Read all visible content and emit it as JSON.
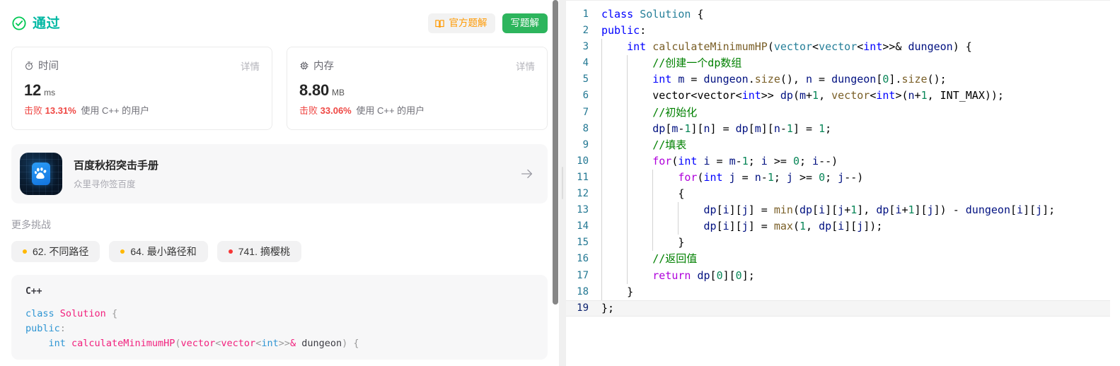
{
  "status": {
    "icon": "circle-check-icon",
    "label": "通过",
    "color": "#00b8a3"
  },
  "actions": {
    "official_solution": {
      "icon": "book-icon",
      "label": "官方题解"
    },
    "write_solution": {
      "label": "写题解"
    }
  },
  "metrics": [
    {
      "key": "time",
      "icon": "stopwatch-icon",
      "label": "时间",
      "detail_label": "详情",
      "value": "12",
      "unit": "ms",
      "beat_label": "击败",
      "beat_percent": "13.31%",
      "beat_rest": "使用 C++ 的用户"
    },
    {
      "key": "memory",
      "icon": "chip-icon",
      "label": "内存",
      "detail_label": "详情",
      "value": "8.80",
      "unit": "MB",
      "beat_label": "击败",
      "beat_percent": "33.06%",
      "beat_rest": "使用 C++ 的用户"
    }
  ],
  "promo": {
    "logo_icon": "baidu-paw-icon",
    "title": "百度秋招突击手册",
    "subtitle": "众里寻你签百度",
    "arrow_icon": "arrow-right-icon"
  },
  "more_challenges": {
    "title": "更多挑战",
    "tags": [
      {
        "label": "62. 不同路径",
        "dot_color": "#ffb800"
      },
      {
        "label": "64. 最小路径和",
        "dot_color": "#ffb800"
      },
      {
        "label": "741. 摘樱桃",
        "dot_color": "#f63636"
      }
    ]
  },
  "code_preview": {
    "language": "C++",
    "lines": [
      [
        {
          "t": "class ",
          "c": "p-kw"
        },
        {
          "t": "Solution",
          "c": "p-cls"
        },
        {
          "t": " {",
          "c": "p-pn"
        }
      ],
      [
        {
          "t": "public",
          "c": "p-kw"
        },
        {
          "t": ":",
          "c": "p-pn"
        }
      ],
      [
        {
          "t": "    ",
          "c": "p-var"
        },
        {
          "t": "int",
          "c": "p-type"
        },
        {
          "t": " ",
          "c": "p-var"
        },
        {
          "t": "calculateMinimumHP",
          "c": "p-fn"
        },
        {
          "t": "(",
          "c": "p-pn"
        },
        {
          "t": "vector",
          "c": "p-cls"
        },
        {
          "t": "<",
          "c": "p-pn"
        },
        {
          "t": "vector",
          "c": "p-cls"
        },
        {
          "t": "<",
          "c": "p-pn"
        },
        {
          "t": "int",
          "c": "p-type"
        },
        {
          "t": ">>",
          "c": "p-pn"
        },
        {
          "t": "&",
          "c": "p-amp"
        },
        {
          "t": " dungeon",
          "c": "p-var"
        },
        {
          "t": ") {",
          "c": "p-pn"
        }
      ]
    ]
  },
  "editor": {
    "scrollbar_visible": true,
    "active_line": 19,
    "lines": [
      {
        "n": "1",
        "indent": 0,
        "tokens": [
          {
            "t": "class ",
            "c": "t-kw"
          },
          {
            "t": "Solution",
            "c": "t-cls"
          },
          {
            "t": " {",
            "c": "t-op"
          }
        ]
      },
      {
        "n": "2",
        "indent": 0,
        "tokens": [
          {
            "t": "public",
            "c": "t-kw"
          },
          {
            "t": ":",
            "c": "t-op"
          }
        ]
      },
      {
        "n": "3",
        "indent": 1,
        "tokens": [
          {
            "t": "    ",
            "c": "t-op"
          },
          {
            "t": "int",
            "c": "t-kw"
          },
          {
            "t": " ",
            "c": "t-op"
          },
          {
            "t": "calculateMinimumHP",
            "c": "t-fn"
          },
          {
            "t": "(",
            "c": "t-op"
          },
          {
            "t": "vector",
            "c": "t-cls"
          },
          {
            "t": "<",
            "c": "t-op"
          },
          {
            "t": "vector",
            "c": "t-cls"
          },
          {
            "t": "<",
            "c": "t-op"
          },
          {
            "t": "int",
            "c": "t-kw"
          },
          {
            "t": ">>& ",
            "c": "t-op"
          },
          {
            "t": "dungeon",
            "c": "t-var"
          },
          {
            "t": ") {",
            "c": "t-op"
          }
        ]
      },
      {
        "n": "4",
        "indent": 2,
        "tokens": [
          {
            "t": "        ",
            "c": "t-op"
          },
          {
            "t": "//创建一个dp数组",
            "c": "t-cmt"
          }
        ]
      },
      {
        "n": "5",
        "indent": 2,
        "tokens": [
          {
            "t": "        ",
            "c": "t-op"
          },
          {
            "t": "int",
            "c": "t-kw"
          },
          {
            "t": " ",
            "c": "t-op"
          },
          {
            "t": "m",
            "c": "t-var"
          },
          {
            "t": " = ",
            "c": "t-op"
          },
          {
            "t": "dungeon",
            "c": "t-var"
          },
          {
            "t": ".",
            "c": "t-op"
          },
          {
            "t": "size",
            "c": "t-fn"
          },
          {
            "t": "(), ",
            "c": "t-op"
          },
          {
            "t": "n",
            "c": "t-var"
          },
          {
            "t": " = ",
            "c": "t-op"
          },
          {
            "t": "dungeon",
            "c": "t-var"
          },
          {
            "t": "[",
            "c": "t-op"
          },
          {
            "t": "0",
            "c": "t-num"
          },
          {
            "t": "].",
            "c": "t-op"
          },
          {
            "t": "size",
            "c": "t-fn"
          },
          {
            "t": "();",
            "c": "t-op"
          }
        ]
      },
      {
        "n": "6",
        "indent": 2,
        "tokens": [
          {
            "t": "        vector<vector<",
            "c": "t-op"
          },
          {
            "t": "int",
            "c": "t-kw"
          },
          {
            "t": ">> ",
            "c": "t-op"
          },
          {
            "t": "dp",
            "c": "t-var"
          },
          {
            "t": "(",
            "c": "t-op"
          },
          {
            "t": "m",
            "c": "t-var"
          },
          {
            "t": "+",
            "c": "t-op"
          },
          {
            "t": "1",
            "c": "t-num"
          },
          {
            "t": ", ",
            "c": "t-op"
          },
          {
            "t": "vector",
            "c": "t-fn"
          },
          {
            "t": "<",
            "c": "t-op"
          },
          {
            "t": "int",
            "c": "t-kw"
          },
          {
            "t": ">(",
            "c": "t-op"
          },
          {
            "t": "n",
            "c": "t-var"
          },
          {
            "t": "+",
            "c": "t-op"
          },
          {
            "t": "1",
            "c": "t-num"
          },
          {
            "t": ", ",
            "c": "t-op"
          },
          {
            "t": "INT_MAX",
            "c": "t-op"
          },
          {
            "t": "));",
            "c": "t-op"
          }
        ]
      },
      {
        "n": "7",
        "indent": 2,
        "tokens": [
          {
            "t": "        ",
            "c": "t-op"
          },
          {
            "t": "//初始化",
            "c": "t-cmt"
          }
        ]
      },
      {
        "n": "8",
        "indent": 2,
        "tokens": [
          {
            "t": "        ",
            "c": "t-op"
          },
          {
            "t": "dp",
            "c": "t-var"
          },
          {
            "t": "[",
            "c": "t-op"
          },
          {
            "t": "m",
            "c": "t-var"
          },
          {
            "t": "-",
            "c": "t-op"
          },
          {
            "t": "1",
            "c": "t-num"
          },
          {
            "t": "][",
            "c": "t-op"
          },
          {
            "t": "n",
            "c": "t-var"
          },
          {
            "t": "] = ",
            "c": "t-op"
          },
          {
            "t": "dp",
            "c": "t-var"
          },
          {
            "t": "[",
            "c": "t-op"
          },
          {
            "t": "m",
            "c": "t-var"
          },
          {
            "t": "][",
            "c": "t-op"
          },
          {
            "t": "n",
            "c": "t-var"
          },
          {
            "t": "-",
            "c": "t-op"
          },
          {
            "t": "1",
            "c": "t-num"
          },
          {
            "t": "] = ",
            "c": "t-op"
          },
          {
            "t": "1",
            "c": "t-num"
          },
          {
            "t": ";",
            "c": "t-op"
          }
        ]
      },
      {
        "n": "9",
        "indent": 2,
        "tokens": [
          {
            "t": "        ",
            "c": "t-op"
          },
          {
            "t": "//填表",
            "c": "t-cmt"
          }
        ]
      },
      {
        "n": "10",
        "indent": 2,
        "tokens": [
          {
            "t": "        ",
            "c": "t-op"
          },
          {
            "t": "for",
            "c": "t-ctl"
          },
          {
            "t": "(",
            "c": "t-op"
          },
          {
            "t": "int",
            "c": "t-kw"
          },
          {
            "t": " ",
            "c": "t-op"
          },
          {
            "t": "i",
            "c": "t-var"
          },
          {
            "t": " = ",
            "c": "t-op"
          },
          {
            "t": "m",
            "c": "t-var"
          },
          {
            "t": "-",
            "c": "t-op"
          },
          {
            "t": "1",
            "c": "t-num"
          },
          {
            "t": "; ",
            "c": "t-op"
          },
          {
            "t": "i",
            "c": "t-var"
          },
          {
            "t": " >= ",
            "c": "t-op"
          },
          {
            "t": "0",
            "c": "t-num"
          },
          {
            "t": "; ",
            "c": "t-op"
          },
          {
            "t": "i",
            "c": "t-var"
          },
          {
            "t": "--)",
            "c": "t-op"
          }
        ]
      },
      {
        "n": "11",
        "indent": 3,
        "tokens": [
          {
            "t": "            ",
            "c": "t-op"
          },
          {
            "t": "for",
            "c": "t-ctl"
          },
          {
            "t": "(",
            "c": "t-op"
          },
          {
            "t": "int",
            "c": "t-kw"
          },
          {
            "t": " ",
            "c": "t-op"
          },
          {
            "t": "j",
            "c": "t-var"
          },
          {
            "t": " = ",
            "c": "t-op"
          },
          {
            "t": "n",
            "c": "t-var"
          },
          {
            "t": "-",
            "c": "t-op"
          },
          {
            "t": "1",
            "c": "t-num"
          },
          {
            "t": "; ",
            "c": "t-op"
          },
          {
            "t": "j",
            "c": "t-var"
          },
          {
            "t": " >= ",
            "c": "t-op"
          },
          {
            "t": "0",
            "c": "t-num"
          },
          {
            "t": "; ",
            "c": "t-op"
          },
          {
            "t": "j",
            "c": "t-var"
          },
          {
            "t": "--)",
            "c": "t-op"
          }
        ]
      },
      {
        "n": "12",
        "indent": 3,
        "tokens": [
          {
            "t": "            {",
            "c": "t-op"
          }
        ]
      },
      {
        "n": "13",
        "indent": 4,
        "tokens": [
          {
            "t": "                ",
            "c": "t-op"
          },
          {
            "t": "dp",
            "c": "t-var"
          },
          {
            "t": "[",
            "c": "t-op"
          },
          {
            "t": "i",
            "c": "t-var"
          },
          {
            "t": "][",
            "c": "t-op"
          },
          {
            "t": "j",
            "c": "t-var"
          },
          {
            "t": "] = ",
            "c": "t-op"
          },
          {
            "t": "min",
            "c": "t-fn"
          },
          {
            "t": "(",
            "c": "t-op"
          },
          {
            "t": "dp",
            "c": "t-var"
          },
          {
            "t": "[",
            "c": "t-op"
          },
          {
            "t": "i",
            "c": "t-var"
          },
          {
            "t": "][",
            "c": "t-op"
          },
          {
            "t": "j",
            "c": "t-var"
          },
          {
            "t": "+",
            "c": "t-op"
          },
          {
            "t": "1",
            "c": "t-num"
          },
          {
            "t": "], ",
            "c": "t-op"
          },
          {
            "t": "dp",
            "c": "t-var"
          },
          {
            "t": "[",
            "c": "t-op"
          },
          {
            "t": "i",
            "c": "t-var"
          },
          {
            "t": "+",
            "c": "t-op"
          },
          {
            "t": "1",
            "c": "t-num"
          },
          {
            "t": "][",
            "c": "t-op"
          },
          {
            "t": "j",
            "c": "t-var"
          },
          {
            "t": "]) - ",
            "c": "t-op"
          },
          {
            "t": "dungeon",
            "c": "t-var"
          },
          {
            "t": "[",
            "c": "t-op"
          },
          {
            "t": "i",
            "c": "t-var"
          },
          {
            "t": "][",
            "c": "t-op"
          },
          {
            "t": "j",
            "c": "t-var"
          },
          {
            "t": "];",
            "c": "t-op"
          }
        ]
      },
      {
        "n": "14",
        "indent": 4,
        "tokens": [
          {
            "t": "                ",
            "c": "t-op"
          },
          {
            "t": "dp",
            "c": "t-var"
          },
          {
            "t": "[",
            "c": "t-op"
          },
          {
            "t": "i",
            "c": "t-var"
          },
          {
            "t": "][",
            "c": "t-op"
          },
          {
            "t": "j",
            "c": "t-var"
          },
          {
            "t": "] = ",
            "c": "t-op"
          },
          {
            "t": "max",
            "c": "t-fn"
          },
          {
            "t": "(",
            "c": "t-op"
          },
          {
            "t": "1",
            "c": "t-num"
          },
          {
            "t": ", ",
            "c": "t-op"
          },
          {
            "t": "dp",
            "c": "t-var"
          },
          {
            "t": "[",
            "c": "t-op"
          },
          {
            "t": "i",
            "c": "t-var"
          },
          {
            "t": "][",
            "c": "t-op"
          },
          {
            "t": "j",
            "c": "t-var"
          },
          {
            "t": "]);",
            "c": "t-op"
          }
        ]
      },
      {
        "n": "15",
        "indent": 3,
        "tokens": [
          {
            "t": "            }",
            "c": "t-op"
          }
        ]
      },
      {
        "n": "16",
        "indent": 2,
        "tokens": [
          {
            "t": "        ",
            "c": "t-op"
          },
          {
            "t": "//返回值",
            "c": "t-cmt"
          }
        ]
      },
      {
        "n": "17",
        "indent": 2,
        "tokens": [
          {
            "t": "        ",
            "c": "t-op"
          },
          {
            "t": "return",
            "c": "t-ctl"
          },
          {
            "t": " ",
            "c": "t-op"
          },
          {
            "t": "dp",
            "c": "t-var"
          },
          {
            "t": "[",
            "c": "t-op"
          },
          {
            "t": "0",
            "c": "t-num"
          },
          {
            "t": "][",
            "c": "t-op"
          },
          {
            "t": "0",
            "c": "t-num"
          },
          {
            "t": "];",
            "c": "t-op"
          }
        ]
      },
      {
        "n": "18",
        "indent": 1,
        "tokens": [
          {
            "t": "    }",
            "c": "t-op"
          }
        ]
      },
      {
        "n": "19",
        "indent": 0,
        "tokens": [
          {
            "t": "};",
            "c": "t-op"
          }
        ]
      }
    ]
  }
}
